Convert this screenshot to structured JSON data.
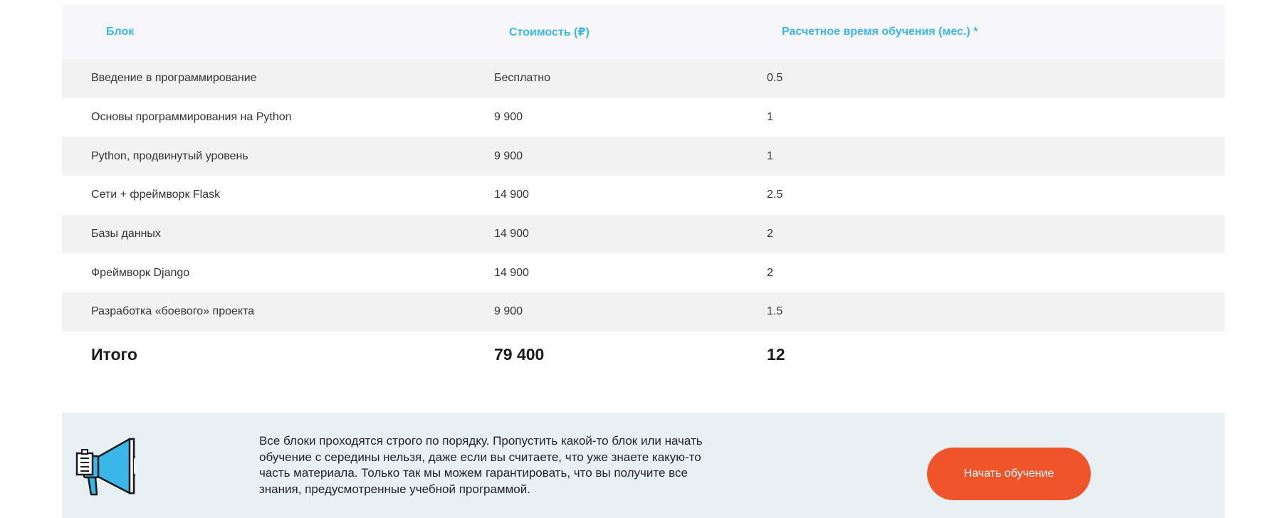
{
  "table": {
    "headers": [
      "Блок",
      "Стоимость (₽)",
      "Расчетное время обучения (мес.) *"
    ],
    "rows": [
      [
        "Введение в программирование",
        "Бесплатно",
        "0.5"
      ],
      [
        "Основы программирования на Python",
        "9 900",
        "1"
      ],
      [
        "Python, продвинутый уровень",
        "9 900",
        "1"
      ],
      [
        "Сети + фреймворк Flask",
        "14 900",
        "2.5"
      ],
      [
        "Базы данных",
        "14 900",
        "2"
      ],
      [
        "Фреймворк Django",
        "14 900",
        "2"
      ],
      [
        "Разработка «боевого» проекта",
        "9 900",
        "1.5"
      ]
    ],
    "total": [
      "Итого",
      "79 400",
      "12"
    ]
  },
  "notice": {
    "icon": "megaphone-icon",
    "text": "Все блоки проходятся строго по порядку. Пропустить какой-то блок или начать обучение с середины нельзя, даже если вы считаете, что уже знаете какую-то часть материала. Только так мы можем гарантировать, что вы получите все знания, предусмотренные учебной программой.",
    "button_label": "Начать обучение"
  },
  "colors": {
    "header_text": "#3bb6e8",
    "accent_button": "#f0542a",
    "notice_background": "#e9f0f3"
  }
}
